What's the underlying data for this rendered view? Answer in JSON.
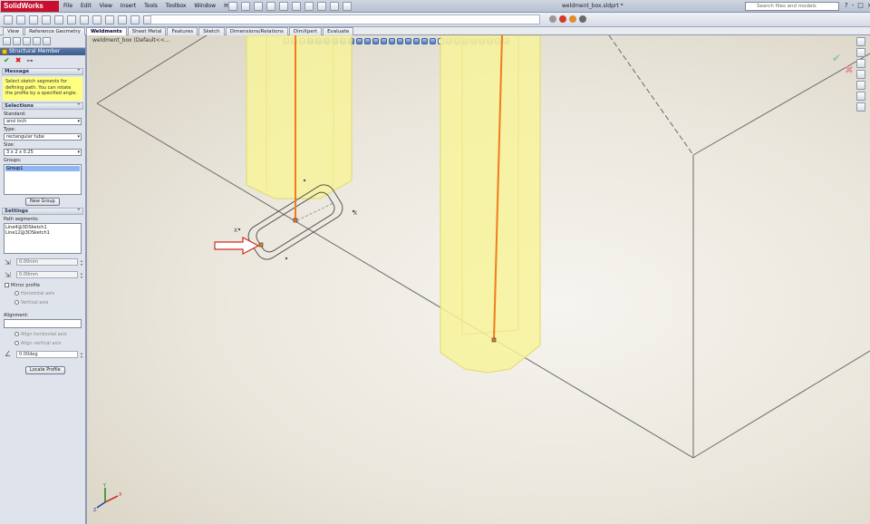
{
  "app": {
    "name": "SolidWorks",
    "doc_title": "weldment_box.sldprt *"
  },
  "menu": [
    "File",
    "Edit",
    "View",
    "Insert",
    "Tools",
    "Toolbox",
    "Window",
    "Help"
  ],
  "search": {
    "placeholder": "Search files and models"
  },
  "help": {
    "q": "?",
    "dash": "-",
    "box": "□",
    "x": "×"
  },
  "tabs": [
    "View",
    "Reference Geometry",
    "Weldments",
    "Sheet Metal",
    "Features",
    "Sketch",
    "Dimensions/Relations",
    "DimXpert",
    "Evaluate"
  ],
  "active_tab": "Weldments",
  "tree": {
    "flyout": "weldment_box (Default<<..."
  },
  "pm": {
    "title": "Structural Member",
    "message_head": "Message",
    "message": "Select sketch segments for defining path. You can rotate the profile by a specified angle.",
    "selections_head": "Selections",
    "standard_label": "Standard:",
    "standard_value": "ansi inch",
    "type_label": "Type:",
    "type_value": "rectangular tube",
    "size_label": "Size:",
    "size_value": "3 x 2 x 0.25",
    "groups_label": "Groups:",
    "groups": [
      "Group1"
    ],
    "new_group": "New Group",
    "settings_head": "Settings",
    "path_label": "Path segments:",
    "path_segments": [
      "Line4@3DSketch1",
      "Line12@3DSketch1"
    ],
    "offset1": "0.00mm",
    "offset2": "0.00mm",
    "mirror_label": "Mirror profile",
    "horizontal_axis": "Horizontal axis",
    "vertical_axis": "Vertical axis",
    "alignment_label": "Alignment:",
    "align_h": "Align horizontal axis",
    "align_v": "Align vertical axis",
    "angle": "0.00deg",
    "locate_profile": "Locate Profile"
  },
  "viewport": {
    "ok": "✔",
    "cancel": "✖",
    "label_x1": "X",
    "label_x2": "X",
    "axis_x": "X",
    "axis_y": "Y",
    "axis_z": "Z"
  },
  "colors": {
    "tube_fill": "#f7f39b",
    "tube_edge": "#e1d96a",
    "path_line": "#f07d1a",
    "arrow": "#d42b1b",
    "pm_header": "#3d5c8c",
    "message_bg": "#ffff7f"
  },
  "icons": [
    "solidworks-logo-icon",
    "new-icon",
    "open-icon",
    "save-icon",
    "print-icon",
    "undo-icon",
    "rebuild-icon",
    "options-icon",
    "search-icon",
    "help-icon",
    "ok-icon",
    "cancel-icon",
    "pushpin-icon",
    "triad-icon"
  ]
}
